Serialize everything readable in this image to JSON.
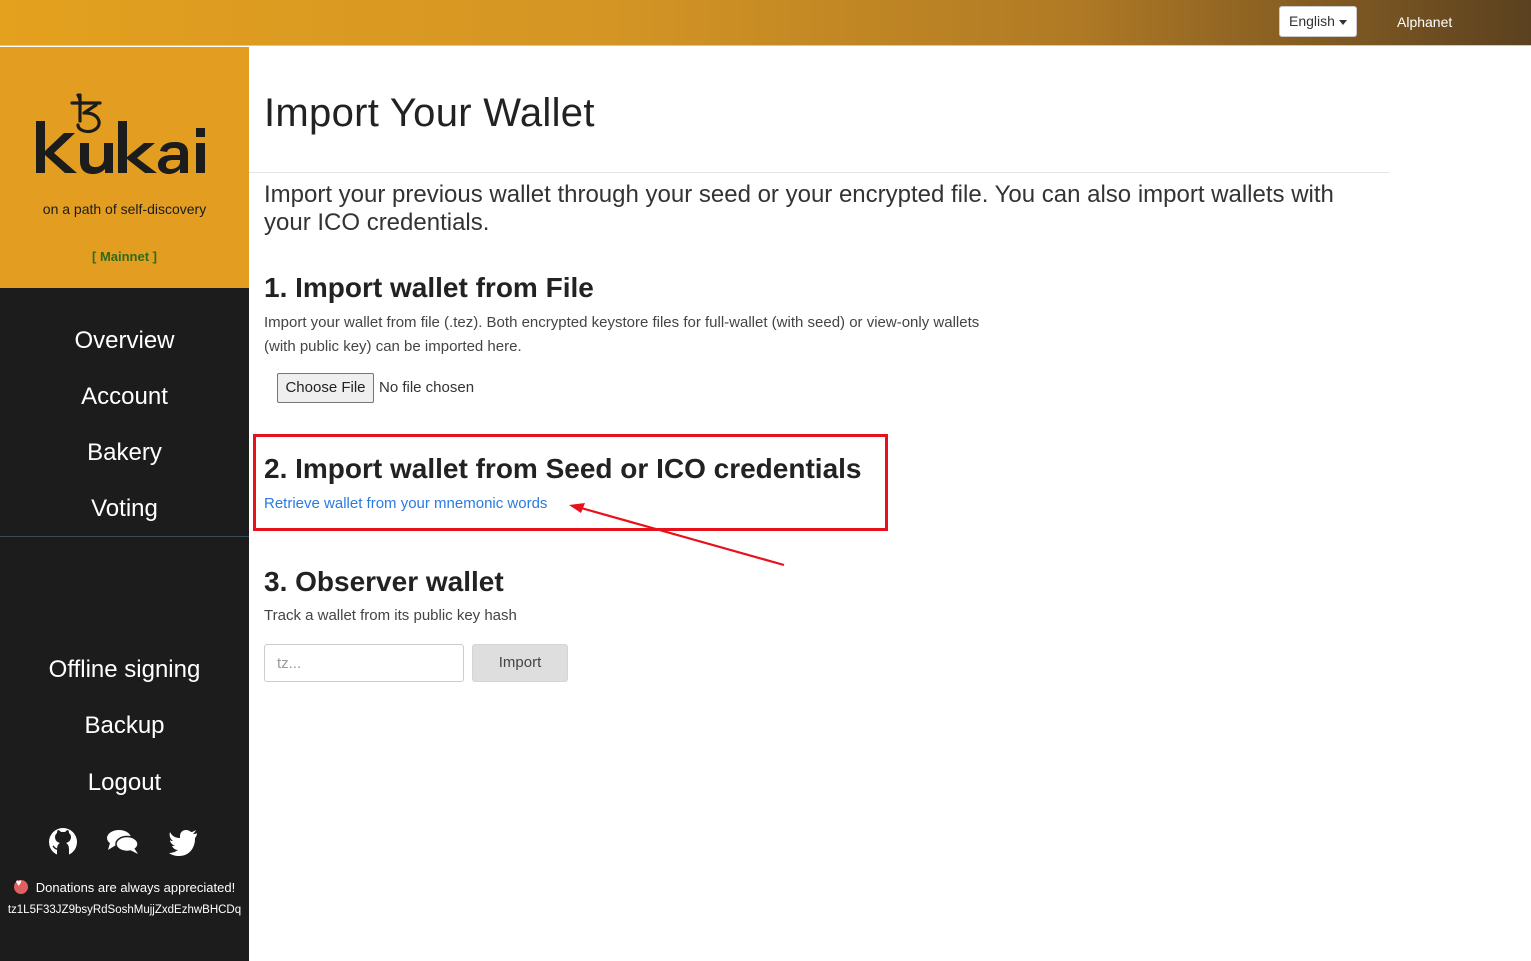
{
  "topbar": {
    "language": "English",
    "network": "Alphanet"
  },
  "sidebar": {
    "logo_text": "kukai",
    "tagline": "on a path of self-discovery",
    "network_badge": "[ Mainnet ]",
    "nav_top": [
      {
        "label": "Overview"
      },
      {
        "label": "Account"
      },
      {
        "label": "Bakery"
      },
      {
        "label": "Voting"
      }
    ],
    "nav_bottom": [
      {
        "label": "Offline signing"
      },
      {
        "label": "Backup"
      },
      {
        "label": "Logout"
      }
    ],
    "socials": [
      "github-icon",
      "chat-icon",
      "twitter-icon"
    ],
    "donation_text": "Donations are always appreciated!",
    "donation_address": "tz1L5F33JZ9bsyRdSoshMujjZxdEzhwBHCDq"
  },
  "main": {
    "title": "Import Your Wallet",
    "intro": "Import your previous wallet through your seed or your encrypted file. You can also import wallets with your ICO credentials.",
    "section1": {
      "heading": "1. Import wallet from File",
      "description": "Import your wallet from file (.tez). Both encrypted keystore files for full-wallet (with seed) or view-only wallets (with public key) can be imported here.",
      "choose_label": "Choose File",
      "file_status": "No file chosen"
    },
    "section2": {
      "heading": "2. Import wallet from Seed or ICO credentials",
      "link": "Retrieve wallet from your mnemonic words"
    },
    "section3": {
      "heading": "3. Observer wallet",
      "description": "Track a wallet from its public key hash",
      "placeholder": "tz...",
      "button": "Import"
    }
  },
  "colors": {
    "brand": "#e39e21",
    "sidebar": "#1c1c1c",
    "annotation": "#e8101a",
    "link": "#2b7ae0"
  }
}
